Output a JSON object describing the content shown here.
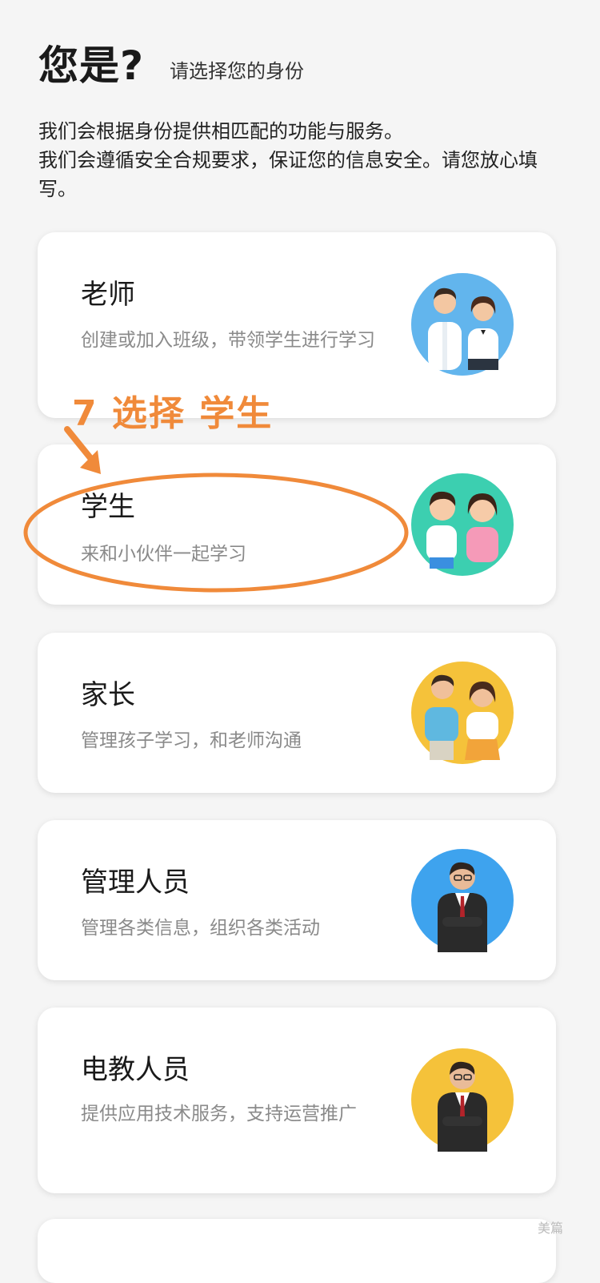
{
  "header": {
    "title": "您是?",
    "subtitle": "请选择您的身份"
  },
  "intro": {
    "line1": "我们会根据身份提供相匹配的功能与服务。",
    "line2": "我们会遵循安全合规要求，保证您的信息安全。请您放心填写。"
  },
  "roles": [
    {
      "title": "老师",
      "desc": "创建或加入班级，带领学生进行学习",
      "icon": "teacher-couple-avatar",
      "avatar_bg": "#4aa7e8"
    },
    {
      "title": "学生",
      "desc": "来和小伙伴一起学习",
      "icon": "students-avatar",
      "avatar_bg": "#3ccfb0"
    },
    {
      "title": "家长",
      "desc": "管理孩子学习，和老师沟通",
      "icon": "parents-avatar",
      "avatar_bg": "#f5c23a"
    },
    {
      "title": "管理人员",
      "desc": "管理各类信息，组织各类活动",
      "icon": "administrator-avatar",
      "avatar_bg": "#3ea3ee"
    },
    {
      "title": "电教人员",
      "desc": "提供应用技术服务，支持运营推广",
      "icon": "edu-tech-staff-avatar",
      "avatar_bg": "#f5c23a"
    }
  ],
  "annotation": {
    "text": "7 选择 学生",
    "color": "#f08a3a"
  },
  "watermark": "美篇"
}
